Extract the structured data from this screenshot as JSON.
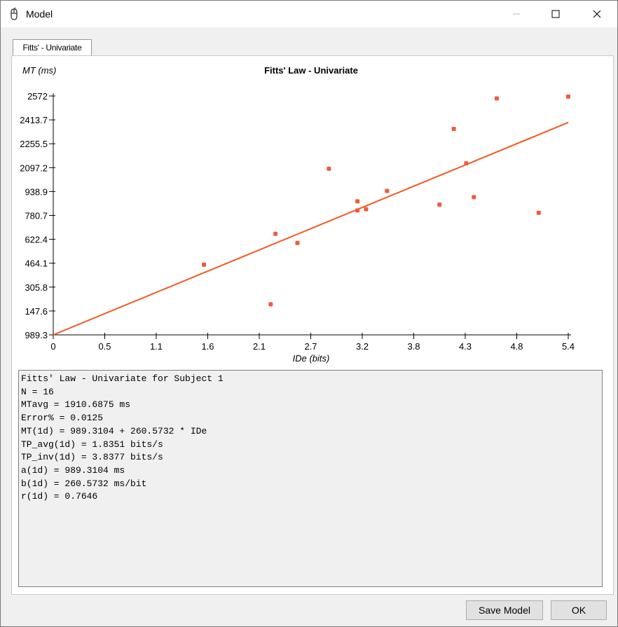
{
  "window": {
    "title": "Model",
    "icon": "mouse-icon"
  },
  "tabs": [
    {
      "label": "Fitts' - Univariate",
      "selected": true
    }
  ],
  "chart_data": {
    "type": "scatter",
    "title": "Fitts' Law - Univariate",
    "xlabel": "IDe (bits)",
    "ylabel": "MT (ms)",
    "xlim": [
      0,
      5.4
    ],
    "ylim": [
      989.3,
      2572
    ],
    "x_ticks": [
      "0",
      "0.5",
      "1.1",
      "1.6",
      "2.1",
      "2.7",
      "3.2",
      "3.8",
      "4.3",
      "4.8",
      "5.4"
    ],
    "x_tick_values": [
      0,
      0.54,
      1.08,
      1.62,
      2.16,
      2.7,
      3.24,
      3.78,
      4.32,
      4.86,
      5.4
    ],
    "y_ticks": [
      "989.3",
      "147.6",
      "305.8",
      "464.1",
      "622.4",
      "780.7",
      "938.9",
      "2097.2",
      "2255.5",
      "2413.7",
      "2572"
    ],
    "y_tick_values": [
      989.3,
      1147.6,
      1305.8,
      1464.1,
      1622.4,
      1780.7,
      1938.9,
      2097.2,
      2255.5,
      2413.7,
      2572
    ],
    "grid": false,
    "series": [
      {
        "marker": "point",
        "color": "#f05a3c",
        "points": [
          [
            1.58,
            1454
          ],
          [
            2.28,
            1192
          ],
          [
            2.33,
            1659
          ],
          [
            2.56,
            1598
          ],
          [
            2.89,
            2090
          ],
          [
            3.19,
            1874
          ],
          [
            3.19,
            1814
          ],
          [
            3.28,
            1822
          ],
          [
            3.5,
            1943
          ],
          [
            4.05,
            1852
          ],
          [
            4.2,
            2354
          ],
          [
            4.33,
            2126
          ],
          [
            4.41,
            1902
          ],
          [
            4.65,
            2556
          ],
          [
            5.09,
            1798
          ],
          [
            5.4,
            2568
          ]
        ]
      },
      {
        "type": "line",
        "color": "#f05a1e",
        "points": [
          [
            0,
            989.3104
          ],
          [
            5.4,
            2396.41
          ]
        ]
      }
    ]
  },
  "results": {
    "lines": [
      "Fitts' Law - Univariate for Subject 1",
      "N = 16",
      "MTavg = 1910.6875 ms",
      "Error% = 0.0125",
      "MT(1d) = 989.3104 + 260.5732 * IDe",
      "TP_avg(1d) = 1.8351 bits/s",
      "TP_inv(1d) = 3.8377 bits/s",
      "a(1d) = 989.3104 ms",
      "b(1d) = 260.5732 ms/bit",
      "r(1d) = 0.7646"
    ]
  },
  "buttons": {
    "save_label": "Save Model",
    "ok_label": "OK"
  }
}
